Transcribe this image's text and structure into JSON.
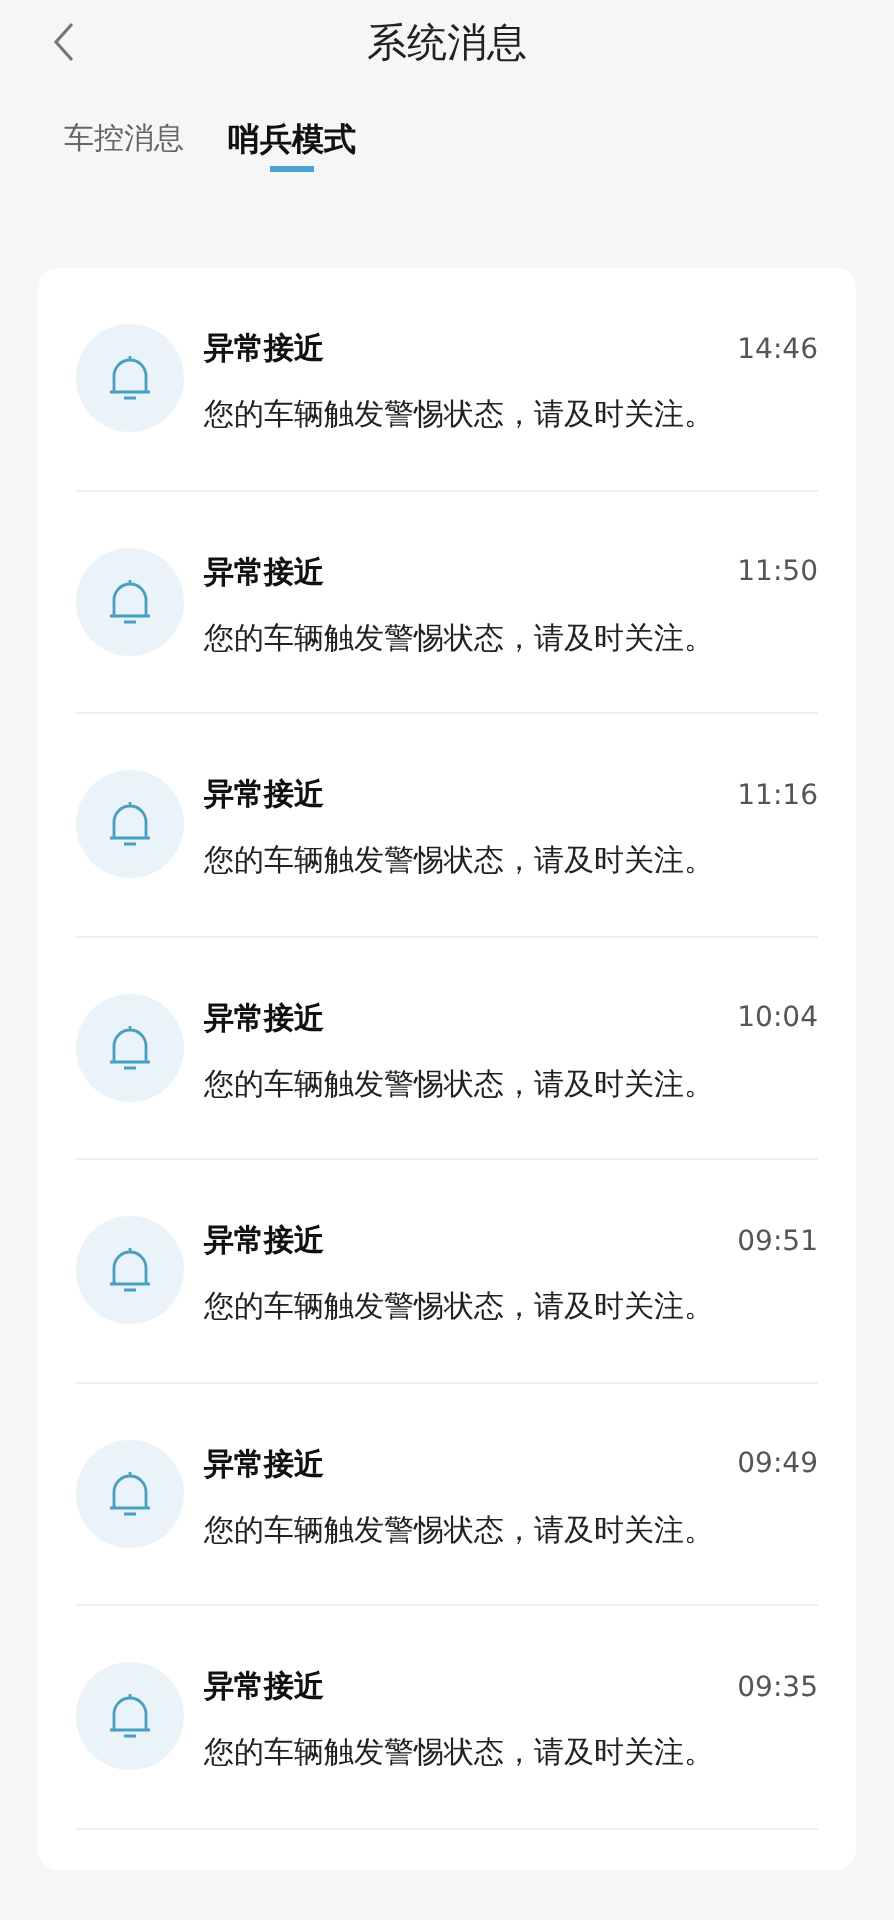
{
  "header": {
    "title": "系统消息"
  },
  "tabs": [
    {
      "label": "车控消息",
      "selected": false
    },
    {
      "label": "哨兵模式",
      "selected": true
    }
  ],
  "messages": [
    {
      "title": "异常接近",
      "time": "14:46",
      "body": "您的车辆触发警惕状态，请及时关注。"
    },
    {
      "title": "异常接近",
      "time": "11:50",
      "body": "您的车辆触发警惕状态，请及时关注。"
    },
    {
      "title": "异常接近",
      "time": "11:16",
      "body": "您的车辆触发警惕状态，请及时关注。"
    },
    {
      "title": "异常接近",
      "time": "10:04",
      "body": "您的车辆触发警惕状态，请及时关注。"
    },
    {
      "title": "异常接近",
      "time": "09:51",
      "body": "您的车辆触发警惕状态，请及时关注。"
    },
    {
      "title": "异常接近",
      "time": "09:49",
      "body": "您的车辆触发警惕状态，请及时关注。"
    },
    {
      "title": "异常接近",
      "time": "09:35",
      "body": "您的车辆触发警惕状态，请及时关注。"
    }
  ]
}
